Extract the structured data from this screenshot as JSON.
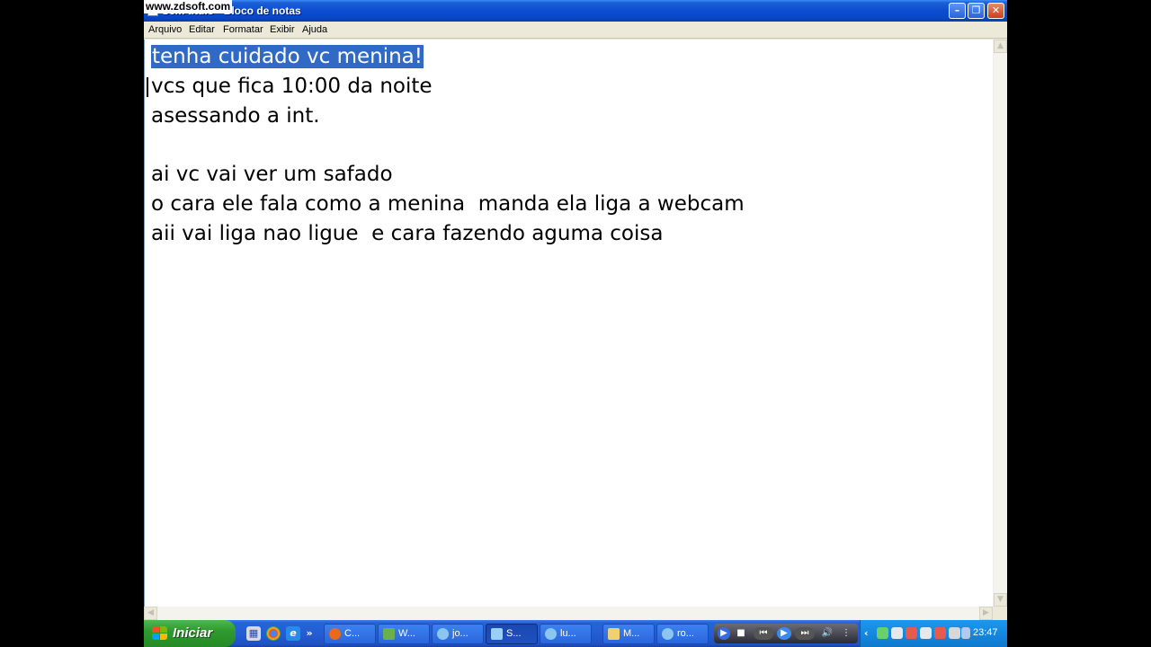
{
  "watermark": "www.zdsoft.com",
  "window": {
    "title": "Sem título - Bloco de notas"
  },
  "menu": [
    "Arquivo",
    "Editar",
    "Formatar",
    "Exibir",
    "Ajuda"
  ],
  "document": {
    "lines": [
      "tenha cuidado vc menina!",
      "vcs que fica 10:00 da noite",
      "asessando a int.",
      "",
      "ai vc vai ver um safado",
      "o cara ele fala como a menina  manda ela liga a webcam",
      "aii vai liga nao ligue  e cara fazendo aguma coisa"
    ],
    "selected_line": 0
  },
  "taskbar": {
    "start_label": "Iniciar",
    "tasks": [
      {
        "label": "C...",
        "icon": "firefox-icon"
      },
      {
        "label": "W...",
        "icon": "photo-icon"
      },
      {
        "label": "jo...",
        "icon": "messenger-icon"
      },
      {
        "label": "S...",
        "icon": "notepad-icon",
        "active": true
      },
      {
        "label": "lu...",
        "icon": "messenger-icon"
      },
      {
        "label": "M...",
        "icon": "folder-icon"
      },
      {
        "label": "ro...",
        "icon": "messenger-icon"
      }
    ],
    "clock": "23:47"
  },
  "colors": {
    "selection": "#316ac5",
    "titlebar": "#0a4ed0",
    "start": "#2f9a2f",
    "taskbar": "#245ed4"
  }
}
